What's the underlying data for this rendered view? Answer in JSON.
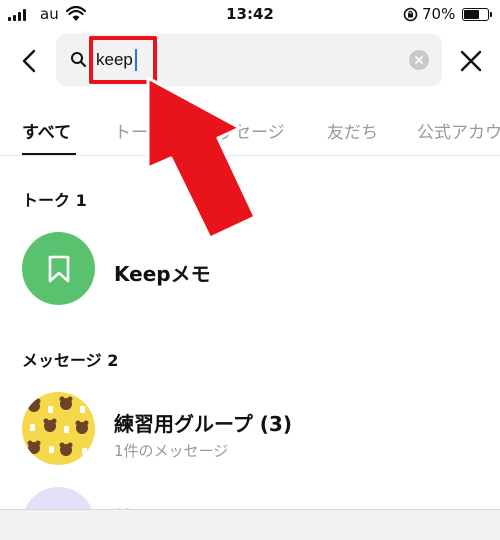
{
  "status_bar": {
    "carrier": "au",
    "time": "13:42",
    "battery": "70%",
    "battery_level": 0.7,
    "icons": [
      "signal-icon",
      "wifi-icon",
      "rotation-lock-icon",
      "battery-icon"
    ]
  },
  "search": {
    "query": "keep",
    "icons": [
      "back-icon",
      "search-icon",
      "clear-icon",
      "close-icon"
    ]
  },
  "tabs": [
    {
      "label": "すべて",
      "active": true
    },
    {
      "label": "トーク",
      "active": false
    },
    {
      "label": "メッセージ",
      "active": false
    },
    {
      "label": "友だち",
      "active": false
    },
    {
      "label": "公式アカウ",
      "active": false
    }
  ],
  "sections": [
    {
      "title": "トーク 1",
      "items": [
        {
          "title": "Keepメモ",
          "icon": "bookmark-icon"
        }
      ]
    },
    {
      "title": "メッセージ 2",
      "items": [
        {
          "title": "練習用グループ (3)",
          "subtitle": "1件のメッセージ"
        },
        {
          "title": "練習用アカウント★"
        }
      ]
    }
  ],
  "annotation": {
    "highlight_color": "#e8141c",
    "arrow_color": "#e8141c"
  },
  "colors": {
    "keep_green": "#5ac26f",
    "group_yellow": "#f6d94a",
    "caret_blue": "#2f6fd8"
  }
}
